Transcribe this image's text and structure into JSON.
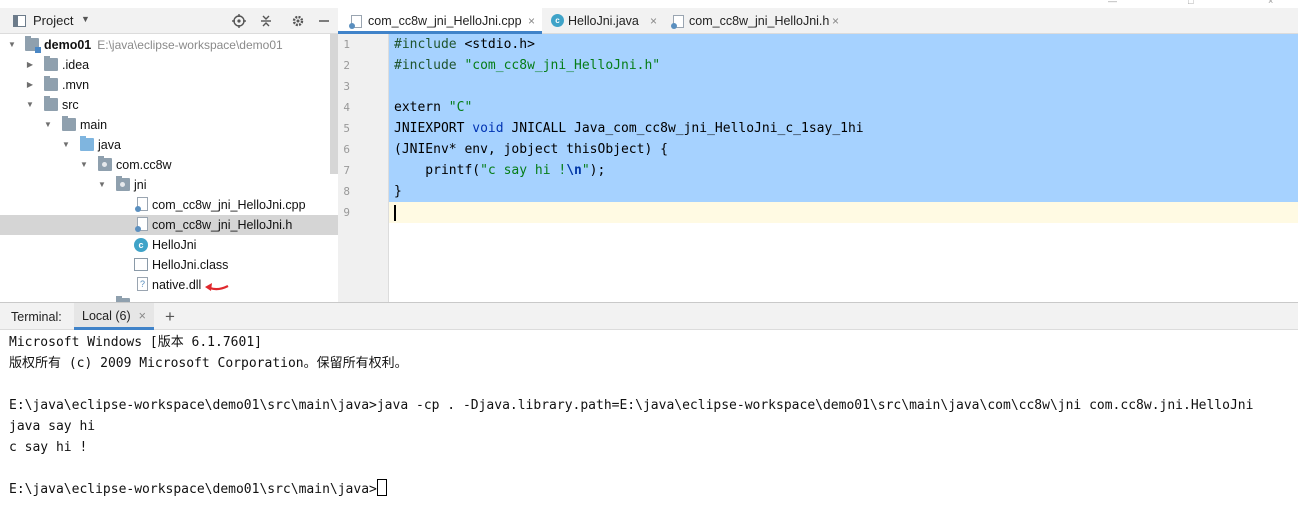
{
  "project_panel": {
    "title": "Project",
    "toolbar": {
      "locate_icon": "crosshair-icon",
      "collapse_icon": "collapse-all-icon",
      "settings_icon": "gear-icon",
      "hide_icon": "minimize-icon"
    }
  },
  "tree": [
    {
      "label": "demo01",
      "path": "E:\\java\\eclipse-workspace\\demo01",
      "icon": "module-folder-icon",
      "expanded": true
    },
    {
      "label": ".idea",
      "icon": "folder-icon",
      "expanded": false
    },
    {
      "label": ".mvn",
      "icon": "folder-icon",
      "expanded": false
    },
    {
      "label": "src",
      "icon": "folder-icon",
      "expanded": true
    },
    {
      "label": "main",
      "icon": "folder-icon",
      "expanded": true
    },
    {
      "label": "java",
      "icon": "source-folder-icon",
      "expanded": true
    },
    {
      "label": "com.cc8w",
      "icon": "package-icon",
      "expanded": true
    },
    {
      "label": "jni",
      "icon": "package-icon",
      "expanded": true
    },
    {
      "label": "com_cc8w_jni_HelloJni.cpp",
      "icon": "cpp-file-icon"
    },
    {
      "label": "com_cc8w_jni_HelloJni.h",
      "icon": "header-file-icon",
      "selected": true
    },
    {
      "label": "HelloJni",
      "icon": "java-class-icon"
    },
    {
      "label": "HelloJni.class",
      "icon": "class-file-icon"
    },
    {
      "label": "native.dll",
      "icon": "dll-file-icon"
    }
  ],
  "editor_tabs": [
    {
      "label": "com_cc8w_jni_HelloJni.cpp",
      "close": "×",
      "active": true
    },
    {
      "label": "HelloJni.java",
      "close": "×",
      "active": false
    },
    {
      "label": "com_cc8w_jni_HelloJni.h",
      "close": "×",
      "active": false
    }
  ],
  "editor": {
    "line_numbers": [
      "1",
      "2",
      "3",
      "4",
      "5",
      "6",
      "7",
      "8",
      "9"
    ],
    "lines": [
      [
        {
          "t": "#include ",
          "c": "dir"
        },
        {
          "t": "<stdio.h>",
          "c": "plain"
        }
      ],
      [
        {
          "t": "#include ",
          "c": "dir"
        },
        {
          "t": "\"com_cc8w_jni_HelloJni.h\"",
          "c": "str"
        }
      ],
      [],
      [
        {
          "t": "extern ",
          "c": "plain"
        },
        {
          "t": "\"C\"",
          "c": "str"
        }
      ],
      [
        {
          "t": "JNIEXPORT ",
          "c": "plain"
        },
        {
          "t": "void ",
          "c": "kw"
        },
        {
          "t": "JNICALL Java_com_cc8w_jni_HelloJni_c_1say_1hi",
          "c": "plain"
        }
      ],
      [
        {
          "t": "(JNIEnv* env, jobject thisObject) {",
          "c": "plain"
        }
      ],
      [
        {
          "t": "    printf(",
          "c": "plain"
        },
        {
          "t": "\"c say hi !",
          "c": "str"
        },
        {
          "t": "\\n",
          "c": "esc"
        },
        {
          "t": "\"",
          "c": "str"
        },
        {
          "t": ");",
          "c": "plain"
        }
      ],
      [
        {
          "t": "}",
          "c": "plain"
        }
      ],
      []
    ]
  },
  "terminal": {
    "label": "Terminal:",
    "tab_label": "Local (6)",
    "tab_close": "×",
    "add_label": "+",
    "lines": [
      "Microsoft Windows [版本 6.1.7601]",
      "版权所有 (c) 2009 Microsoft Corporation。保留所有权利。",
      "",
      "E:\\java\\eclipse-workspace\\demo01\\src\\main\\java>java -cp . -Djava.library.path=E:\\java\\eclipse-workspace\\demo01\\src\\main\\java\\com\\cc8w\\jni com.cc8w.jni.HelloJni",
      "java say hi",
      "c say hi !",
      "",
      "E:\\java\\eclipse-workspace\\demo01\\src\\main\\java>"
    ]
  },
  "colors": {
    "selection": "#a6d2ff",
    "current_line": "#fffae3",
    "active_tab_underline": "#4083c9",
    "annotation_arrow": "#e0282d"
  }
}
